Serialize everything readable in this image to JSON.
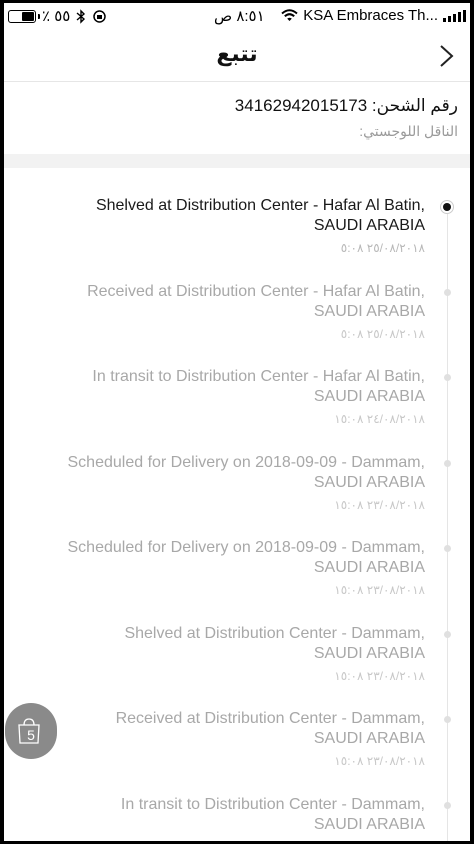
{
  "status_bar": {
    "battery_percent_text": "٪ ٥٥",
    "battery_level": 0.55,
    "time": "٨:٥١ ص",
    "carrier": "KSA Embraces Th..."
  },
  "nav": {
    "title": "تتبع",
    "back_icon": "chevron-right-icon"
  },
  "shipment": {
    "tracking_label": "رقم الشحن:",
    "tracking_number": "34162942015173",
    "carrier_label": "الناقل اللوجستي:"
  },
  "events": [
    {
      "desc_line1": "Shelved at Distribution Center - Hafar Al Batin,",
      "desc_line2": "SAUDI ARABIA",
      "date": "٢٥/٠٨/٢٠١٨ ٥:٠٨",
      "active": true
    },
    {
      "desc_line1": "Received at Distribution Center - Hafar Al Batin,",
      "desc_line2": "SAUDI ARABIA",
      "date": "٢٥/٠٨/٢٠١٨ ٥:٠٨",
      "active": false
    },
    {
      "desc_line1": "In transit to Distribution Center - Hafar Al Batin,",
      "desc_line2": "SAUDI ARABIA",
      "date": "٢٤/٠٨/٢٠١٨ ١٥:٠٨",
      "active": false
    },
    {
      "desc_line1": "Scheduled for Delivery on 2018-09-09 - Dammam,",
      "desc_line2": "SAUDI ARABIA",
      "date": "٢٣/٠٨/٢٠١٨ ١٥:٠٨",
      "active": false
    },
    {
      "desc_line1": "Scheduled for Delivery on 2018-09-09 - Dammam,",
      "desc_line2": "SAUDI ARABIA",
      "date": "٢٣/٠٨/٢٠١٨ ١٥:٠٨",
      "active": false
    },
    {
      "desc_line1": "Shelved at Distribution Center - Dammam,",
      "desc_line2": "SAUDI ARABIA",
      "date": "٢٣/٠٨/٢٠١٨ ١٥:٠٨",
      "active": false
    },
    {
      "desc_line1": "Received at Distribution Center - Dammam,",
      "desc_line2": "SAUDI ARABIA",
      "date": "٢٣/٠٨/٢٠١٨ ١٥:٠٨",
      "active": false
    },
    {
      "desc_line1": "In transit to Distribution Center - Dammam,",
      "desc_line2": "SAUDI ARABIA",
      "date": "",
      "active": false
    }
  ],
  "cart": {
    "count": "5",
    "icon": "shopping-bag-icon"
  }
}
